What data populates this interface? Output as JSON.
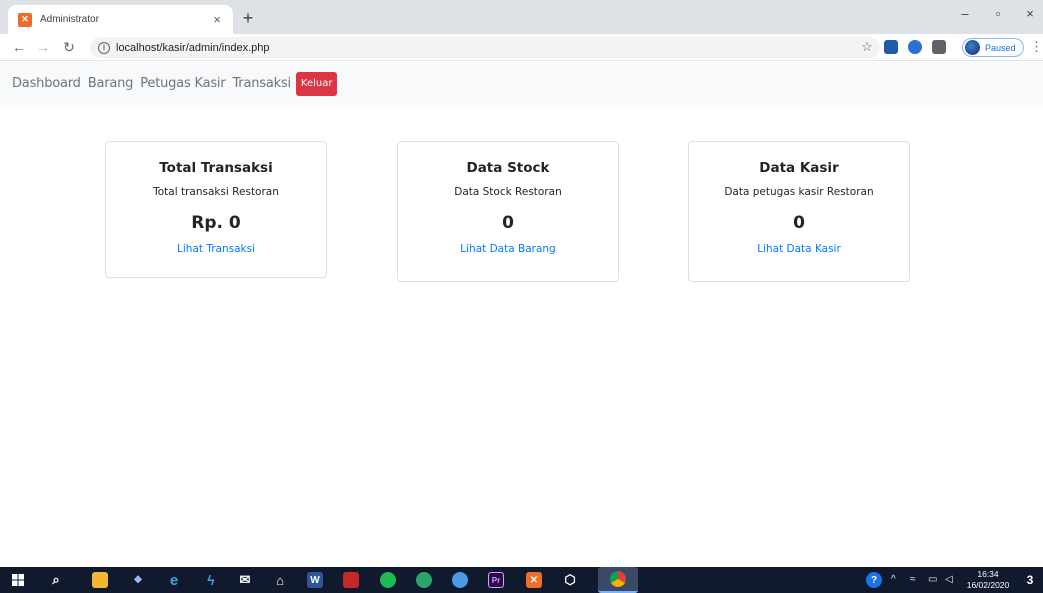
{
  "browser": {
    "tab_title": "Administrator",
    "tab_close": "×",
    "new_tab": "+",
    "url": "localhost/kasir/admin/index.php",
    "profile_status": "Paused",
    "window_controls": {
      "minimize": "–",
      "restore": "▫",
      "close": "×"
    }
  },
  "navbar": {
    "items": [
      "Dashboard",
      "Barang",
      "Petugas Kasir",
      "Transaksi"
    ],
    "logout_label": "Keluar"
  },
  "cards": [
    {
      "title": "Total Transaksi",
      "subtitle": "Total transaksi Restoran",
      "value": "Rp. 0",
      "link": "Lihat Transaksi"
    },
    {
      "title": "Data Stock",
      "subtitle": "Data Stock Restoran",
      "value": "0",
      "link": "Lihat Data Barang"
    },
    {
      "title": "Data Kasir",
      "subtitle": "Data petugas kasir Restoran",
      "value": "0",
      "link": "Lihat Data Kasir"
    }
  ],
  "taskbar": {
    "time": "16:34",
    "date": "16/02/2020",
    "notification_count": "3"
  },
  "colors": {
    "danger": "#dc3545",
    "link": "#007bff",
    "navbar_bg": "#f8f9fa",
    "taskbar_bg": "#101a2c"
  }
}
